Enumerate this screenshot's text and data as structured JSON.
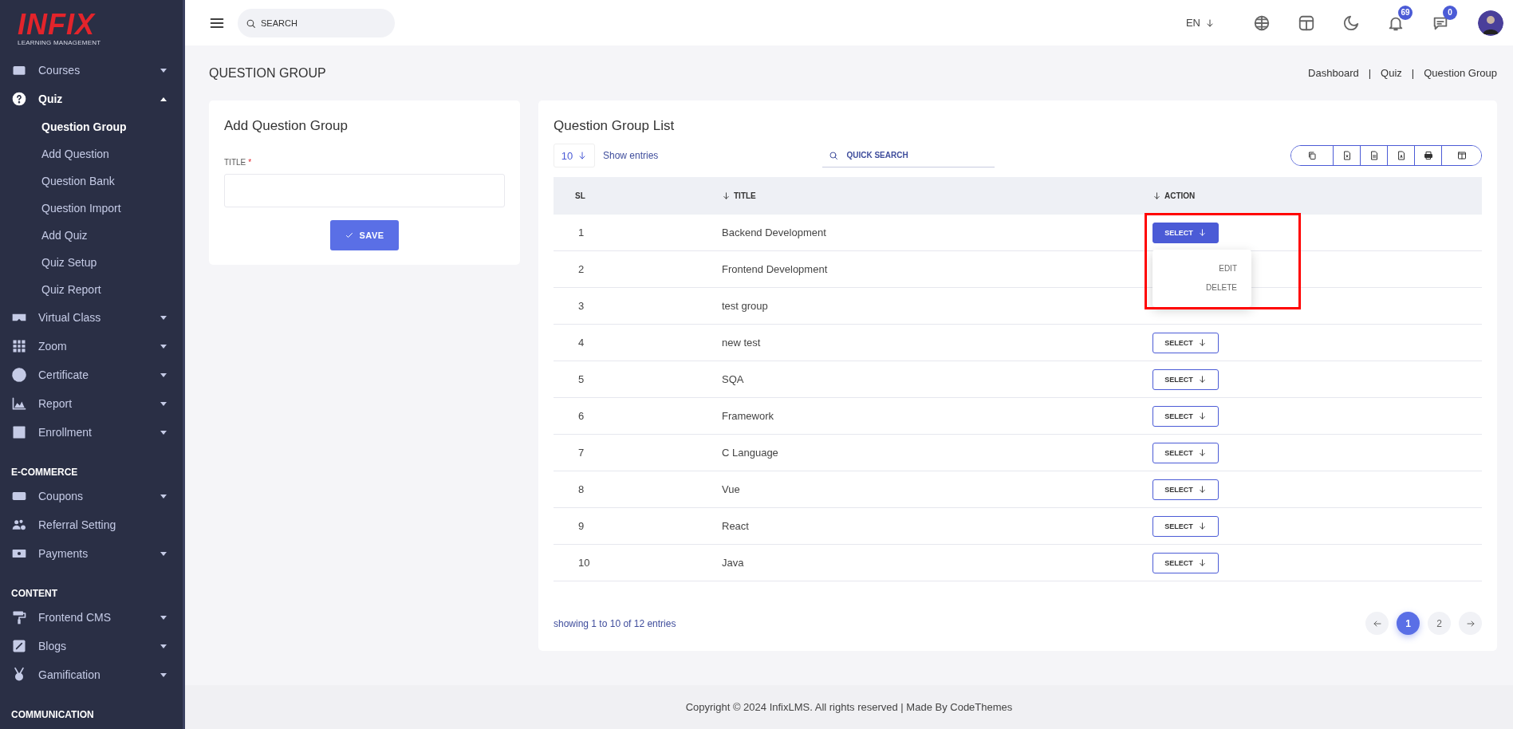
{
  "brand": {
    "name": "INFIX",
    "tagline": "LEARNING MANAGEMENT"
  },
  "sidebar": {
    "sections": [
      {
        "items": [
          {
            "label": "Courses",
            "submenu": true,
            "expanded": false
          },
          {
            "label": "Quiz",
            "submenu": true,
            "expanded": true,
            "children": [
              {
                "label": "Question Group",
                "selected": true
              },
              {
                "label": "Add Question",
                "selected": false
              },
              {
                "label": "Question Bank",
                "selected": false
              },
              {
                "label": "Question Import",
                "selected": false
              },
              {
                "label": "Add Quiz",
                "selected": false
              },
              {
                "label": "Quiz Setup",
                "selected": false
              },
              {
                "label": "Quiz Report",
                "selected": false
              }
            ]
          },
          {
            "label": "Virtual Class",
            "submenu": true,
            "expanded": false
          },
          {
            "label": "Zoom",
            "submenu": true,
            "expanded": false
          },
          {
            "label": "Certificate",
            "submenu": true,
            "expanded": false
          },
          {
            "label": "Report",
            "submenu": true,
            "expanded": false
          },
          {
            "label": "Enrollment",
            "submenu": true,
            "expanded": false
          }
        ]
      },
      {
        "heading": "E-COMMERCE",
        "items": [
          {
            "label": "Coupons",
            "submenu": true,
            "expanded": false
          },
          {
            "label": "Referral Setting",
            "submenu": false,
            "expanded": false
          },
          {
            "label": "Payments",
            "submenu": true,
            "expanded": false
          }
        ]
      },
      {
        "heading": "CONTENT",
        "items": [
          {
            "label": "Frontend CMS",
            "submenu": true,
            "expanded": false
          },
          {
            "label": "Blogs",
            "submenu": true,
            "expanded": false
          },
          {
            "label": "Gamification",
            "submenu": true,
            "expanded": false
          }
        ]
      },
      {
        "heading": "COMMUNICATION"
      }
    ]
  },
  "topbar": {
    "search_placeholder": "SEARCH",
    "language": "EN",
    "notifications": "69",
    "messages": "0"
  },
  "page_title": "QUESTION GROUP",
  "breadcrumb": {
    "separator": "|",
    "items": [
      "Dashboard",
      "Quiz",
      "Question Group"
    ]
  },
  "form": {
    "title": "Add Question Group",
    "field_label": "TITLE",
    "required_mark": "*",
    "save": "SAVE"
  },
  "list": {
    "title": "Question Group List",
    "page_size": "10",
    "show_entries": "Show entries",
    "search_placeholder": "QUICK SEARCH",
    "columns": [
      "SL",
      "TITLE",
      "ACTION"
    ],
    "rows": [
      {
        "sl": "1",
        "title": "Backend Development",
        "action": "SELECT",
        "menu_open": true
      },
      {
        "sl": "2",
        "title": "Frontend Development",
        "menu_open": false
      },
      {
        "sl": "3",
        "title": "test group",
        "menu_open": false
      },
      {
        "sl": "4",
        "title": "new test",
        "action": "SELECT",
        "menu_open": false
      },
      {
        "sl": "5",
        "title": "SQA",
        "action": "SELECT",
        "menu_open": false
      },
      {
        "sl": "6",
        "title": "Framework",
        "action": "SELECT",
        "menu_open": false
      },
      {
        "sl": "7",
        "title": "C Language",
        "action": "SELECT",
        "menu_open": false
      },
      {
        "sl": "8",
        "title": "Vue",
        "action": "SELECT",
        "menu_open": false
      },
      {
        "sl": "9",
        "title": "React",
        "action": "SELECT",
        "menu_open": false
      },
      {
        "sl": "10",
        "title": "Java",
        "action": "SELECT",
        "menu_open": false
      }
    ],
    "menu": [
      "EDIT",
      "DELETE"
    ],
    "summary": "showing 1 to 10 of 12 entries",
    "pages": [
      {
        "label": "1",
        "selected": true
      },
      {
        "label": "2",
        "selected": false
      }
    ]
  },
  "footer": "Copyright © 2024 InfixLMS. All rights reserved | Made By CodeThemes"
}
